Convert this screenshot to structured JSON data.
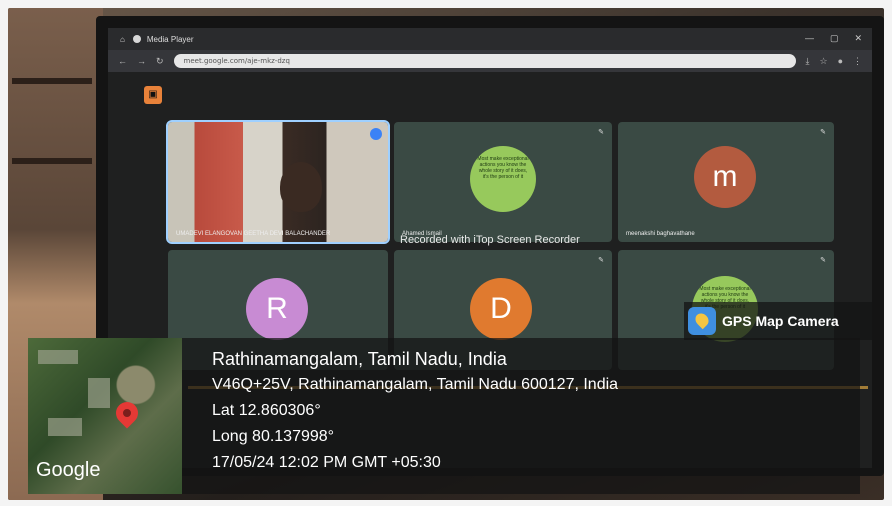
{
  "browser": {
    "tab_title": "Media Player",
    "url": "meet.google.com/aje-mkz-dzq",
    "window_controls": [
      "—",
      "▢",
      "✕"
    ]
  },
  "meet": {
    "tiles": [
      {
        "name": "UMADEVI ELANGOVAN GEETHA DEVI BALACHANDER",
        "type": "camera"
      },
      {
        "name": "Ahamed Ismail",
        "type": "sticker"
      },
      {
        "name": "meenakshi baghavathane",
        "type": "avatar",
        "initial": "m",
        "color": "#b35b3f"
      },
      {
        "name": "",
        "type": "avatar",
        "initial": "R",
        "color": "#c88bd3"
      },
      {
        "name": "",
        "type": "avatar",
        "initial": "D",
        "color": "#e07a2f"
      },
      {
        "name": "",
        "type": "sticker"
      }
    ],
    "sticker_text": "Most make exceptional actions you know the whole story of it does, it's the person of it",
    "watermark": "Recorded with iTop Screen Recorder"
  },
  "gps": {
    "brand": "GPS Map Camera",
    "place": "Rathinamangalam, Tamil Nadu, India",
    "address": "V46Q+25V, Rathinamangalam, Tamil Nadu 600127, India",
    "lat": "Lat 12.860306°",
    "long": "Long 80.137998°",
    "datetime": "17/05/24 12:02 PM GMT +05:30",
    "map_label": "Google"
  }
}
